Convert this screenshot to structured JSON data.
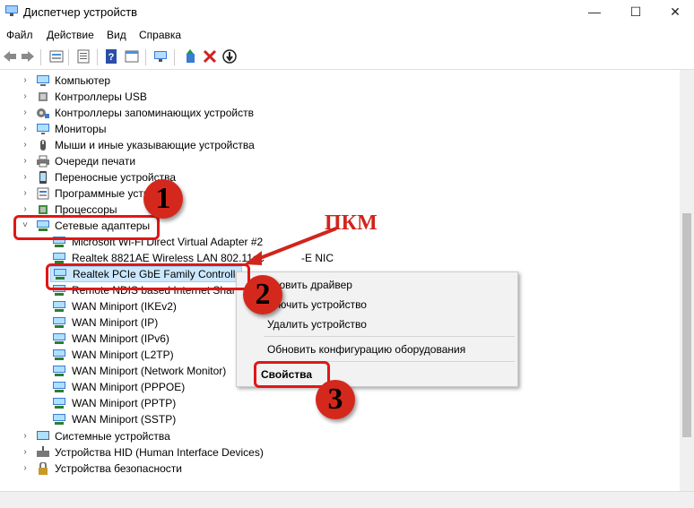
{
  "window": {
    "title": "Диспетчер устройств",
    "min": "—",
    "max": "☐",
    "close": "✕"
  },
  "menu": [
    "Файл",
    "Действие",
    "Вид",
    "Справка"
  ],
  "tree": {
    "categories": [
      "Компьютер",
      "Контроллеры USB",
      "Контроллеры запоминающих устройств",
      "Мониторы",
      "Мыши и иные указывающие устройства",
      "Очереди печати",
      "Переносные устройства",
      "Программные устр",
      "Процессоры",
      "Сетевые адаптеры"
    ],
    "adapters": [
      "Microsoft Wi-Fi Direct Virtual Adapter #2",
      "Realtek 8821AE Wireless LAN 802.11ac",
      "Realtek PCIe GbE Family Controller",
      "Remote NDIS based Internet Sharin",
      "WAN Miniport (IKEv2)",
      "WAN Miniport (IP)",
      "WAN Miniport (IPv6)",
      "WAN Miniport (L2TP)",
      "WAN Miniport (Network Monitor)",
      "WAN Miniport (PPPOE)",
      "WAN Miniport (PPTP)",
      "WAN Miniport (SSTP)"
    ],
    "adapter_suffix": "-E NIC",
    "bottom_categories": [
      "Системные устройства",
      "Устройства HID (Human Interface Devices)",
      "Устройства безопасности"
    ]
  },
  "context_menu": {
    "update_driver": "бновить драйвер",
    "disable_device": "ключить устройство",
    "remove_device": "Удалить устройство",
    "scan_hardware": "Обновить конфигурацию оборудования",
    "properties": "Свойства"
  },
  "annotations": {
    "step1": "1",
    "step2": "2",
    "step3": "3",
    "pkm": "ПКМ"
  },
  "colors": {
    "accent_red": "#d5281c",
    "selection": "#cce8ff"
  }
}
